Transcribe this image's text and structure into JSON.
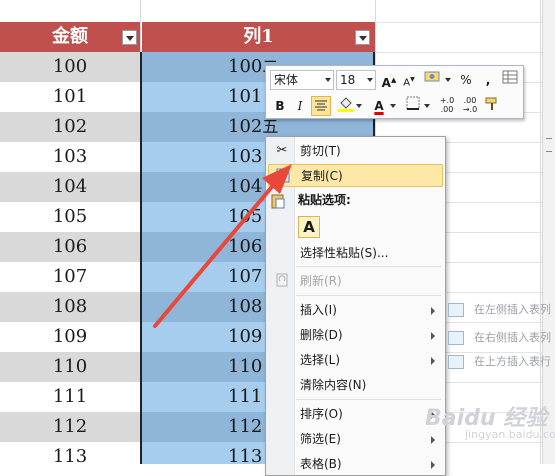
{
  "header": {
    "col_a": "金额",
    "col_b": "列1"
  },
  "rows": [
    {
      "a": "100",
      "b": "100"
    },
    {
      "a": "101",
      "b": "101"
    },
    {
      "a": "102",
      "b": "102"
    },
    {
      "a": "103",
      "b": "103"
    },
    {
      "a": "104",
      "b": "104"
    },
    {
      "a": "105",
      "b": "105"
    },
    {
      "a": "106",
      "b": "106"
    },
    {
      "a": "107",
      "b": "107"
    },
    {
      "a": "108",
      "b": "108"
    },
    {
      "a": "109",
      "b": "109"
    },
    {
      "a": "110",
      "b": "110"
    },
    {
      "a": "111",
      "b": "111"
    },
    {
      "a": "112",
      "b": "112"
    },
    {
      "a": "113",
      "b": "113"
    }
  ],
  "row_tails": {
    "r0": "二",
    "r2": "五"
  },
  "mini_toolbar": {
    "font": "宋体",
    "size": "18",
    "grow": "A",
    "shrink": "A",
    "percent": "%",
    "comma": ",",
    "bold": "B",
    "italic": "I",
    "font_color": "A",
    "inc_decimal": "+.0 .00",
    "dec_decimal": ".00 →.0"
  },
  "context_menu": {
    "cut": "剪切(T)",
    "copy": "复制(C)",
    "paste_header": "粘贴选项:",
    "paste_a": "A",
    "paste_special": "选择性粘贴(S)...",
    "refresh": "刷新(R)",
    "insert": "插入(I)",
    "delete": "删除(D)",
    "select": "选择(L)",
    "clear": "清除内容(N)",
    "sort": "排序(O)",
    "filter": "筛选(E)",
    "table": "表格(B)"
  },
  "submenu": {
    "left": "在左侧插入表列",
    "right": "在右侧插入表列",
    "above": "在上方插入表行"
  },
  "watermark": {
    "brand": "Baidu 经验",
    "url": "jingyan.baidu.com"
  },
  "colors": {
    "header_red": "#c0504d",
    "band_gray": "#d9d9d9",
    "sel_light": "#a6cdee",
    "sel_dark": "#8fb5d8",
    "highlight": "#fde8a8",
    "arrow": "#e8473a"
  }
}
